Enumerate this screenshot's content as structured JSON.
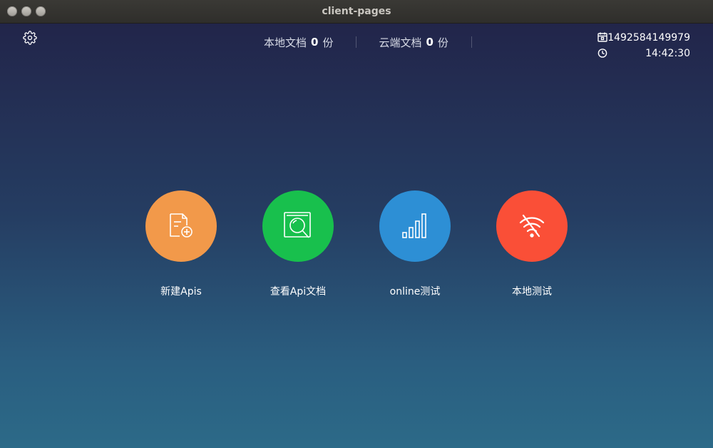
{
  "window": {
    "title": "client-pages"
  },
  "header": {
    "settings_icon": "gear-icon",
    "stats": [
      {
        "prefix": "本地文档",
        "count": "0",
        "suffix": "份"
      },
      {
        "prefix": "云端文档",
        "count": "0",
        "suffix": "份"
      }
    ],
    "timestamp": "1492584149979",
    "timestamp_icon": "calendar-icon",
    "time": "14:42:30",
    "time_icon": "clock-icon"
  },
  "actions": [
    {
      "label": "新建Apis",
      "icon": "new-document-icon",
      "color": "#f2994a"
    },
    {
      "label": "查看Api文档",
      "icon": "search-document-icon",
      "color": "#18c04d"
    },
    {
      "label": "online测试",
      "icon": "signal-bars-icon",
      "color": "#2d8fd5"
    },
    {
      "label": "本地测试",
      "icon": "wifi-off-icon",
      "color": "#fa4f37"
    }
  ]
}
